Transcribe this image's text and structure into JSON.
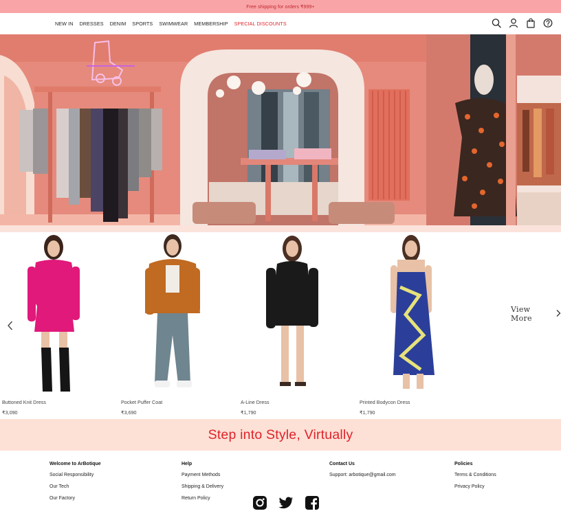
{
  "promo": {
    "text": "Free shipping for orders ₹999+"
  },
  "nav": {
    "links": [
      {
        "label": "NEW IN"
      },
      {
        "label": "DRESSES"
      },
      {
        "label": "DENIM"
      },
      {
        "label": "SPORTS"
      },
      {
        "label": "SWIMWEAR"
      },
      {
        "label": "MEMBERSHIP"
      },
      {
        "label": "SPECIAL DISCOUNTS"
      }
    ],
    "icons": [
      "search-icon",
      "user-icon",
      "shopping-bag-icon",
      "help-icon"
    ],
    "accent_color": "#e0232a"
  },
  "hero": {
    "image": "store-interior-photo"
  },
  "products": {
    "items": [
      {
        "name": "Buttoned Knit Dress",
        "price": "₹3,090",
        "color": "#e0197a"
      },
      {
        "name": "Pocket Puffer Coat",
        "price": "₹3,690",
        "color": "#c06a22"
      },
      {
        "name": "A-Line Dress",
        "price": "₹1,790",
        "color": "#1a1a1a"
      },
      {
        "name": "Printed Bodycon Dress",
        "price": "₹1,790",
        "color": "#2b3f9a"
      }
    ],
    "view_more": "View More",
    "prev_icon": "chevron-left-icon",
    "next_icon": "chevron-right-icon"
  },
  "tagline": {
    "text": "Step into Style, Virtually",
    "color": "#e0232a",
    "background": "#fde0d6"
  },
  "footer": {
    "columns": [
      {
        "title": "Welcome to ArBotique",
        "links": [
          "Social Responsibility",
          "Our Tech",
          "Our Factory"
        ]
      },
      {
        "title": "Help",
        "links": [
          "Payment Methods",
          "Shipping & Delivery",
          "Return Policy"
        ]
      },
      {
        "title": "Contact Us",
        "links": [
          "Support: arbotique@gmail.com"
        ]
      },
      {
        "title": "Policies",
        "links": [
          "Terms & Conditions",
          "Privacy Policy"
        ]
      }
    ],
    "socials": [
      "instagram-icon",
      "twitter-icon",
      "facebook-icon"
    ]
  }
}
